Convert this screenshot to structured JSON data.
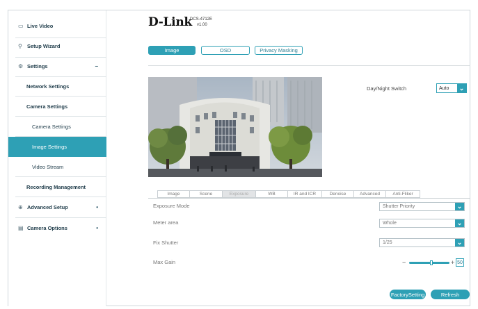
{
  "sidebar": {
    "live_video": {
      "icon": "video-icon",
      "label": "Live Video"
    },
    "setup_wizard": {
      "icon": "wand-icon",
      "label": "Setup Wizard"
    },
    "settings": {
      "icon": "gear-icon",
      "label": "Settings",
      "arrow": "−"
    },
    "network_settings": "Network Settings",
    "camera_settings": "Camera Settings",
    "camera_settings_sub": "Camera Settings",
    "image_settings": "Image Settings",
    "video_stream": "Video Stream",
    "recording_management": "Recording Management",
    "advanced_setup": {
      "icon": "lock-icon",
      "label": "Advanced Setup",
      "arrow": "•"
    },
    "camera_options": {
      "icon": "list-icon",
      "label": "Camera Options",
      "arrow": "•"
    }
  },
  "header": {
    "logo": "D-Link",
    "model": "DCS-4712E",
    "version": "v1.00"
  },
  "top_tabs": [
    "Image",
    "OSD",
    "Privacy Masking"
  ],
  "day_night": {
    "label": "Day/Night Switch",
    "value": "Auto"
  },
  "sub_tabs": [
    "Image",
    "Scene",
    "Exposure",
    "WB",
    "IR and ICR",
    "Denoise",
    "Advanced",
    "Anti-Fliker"
  ],
  "form": {
    "exposure_mode": {
      "label": "Exposure Mode",
      "value": "Shutter Priority"
    },
    "meter_area": {
      "label": "Meter area",
      "value": "Whole"
    },
    "fix_shutter": {
      "label": "Fix Shutter",
      "value": "1/25"
    },
    "max_gain": {
      "label": "Max Gain",
      "minus": "−",
      "plus": "+",
      "value": "50",
      "level": 0.55
    }
  },
  "buttons": {
    "factory": "FactorySetting",
    "refresh": "Refresh"
  },
  "colors": {
    "accent": "#2ea0b5",
    "sidebar_text": "#1f3c4a"
  }
}
